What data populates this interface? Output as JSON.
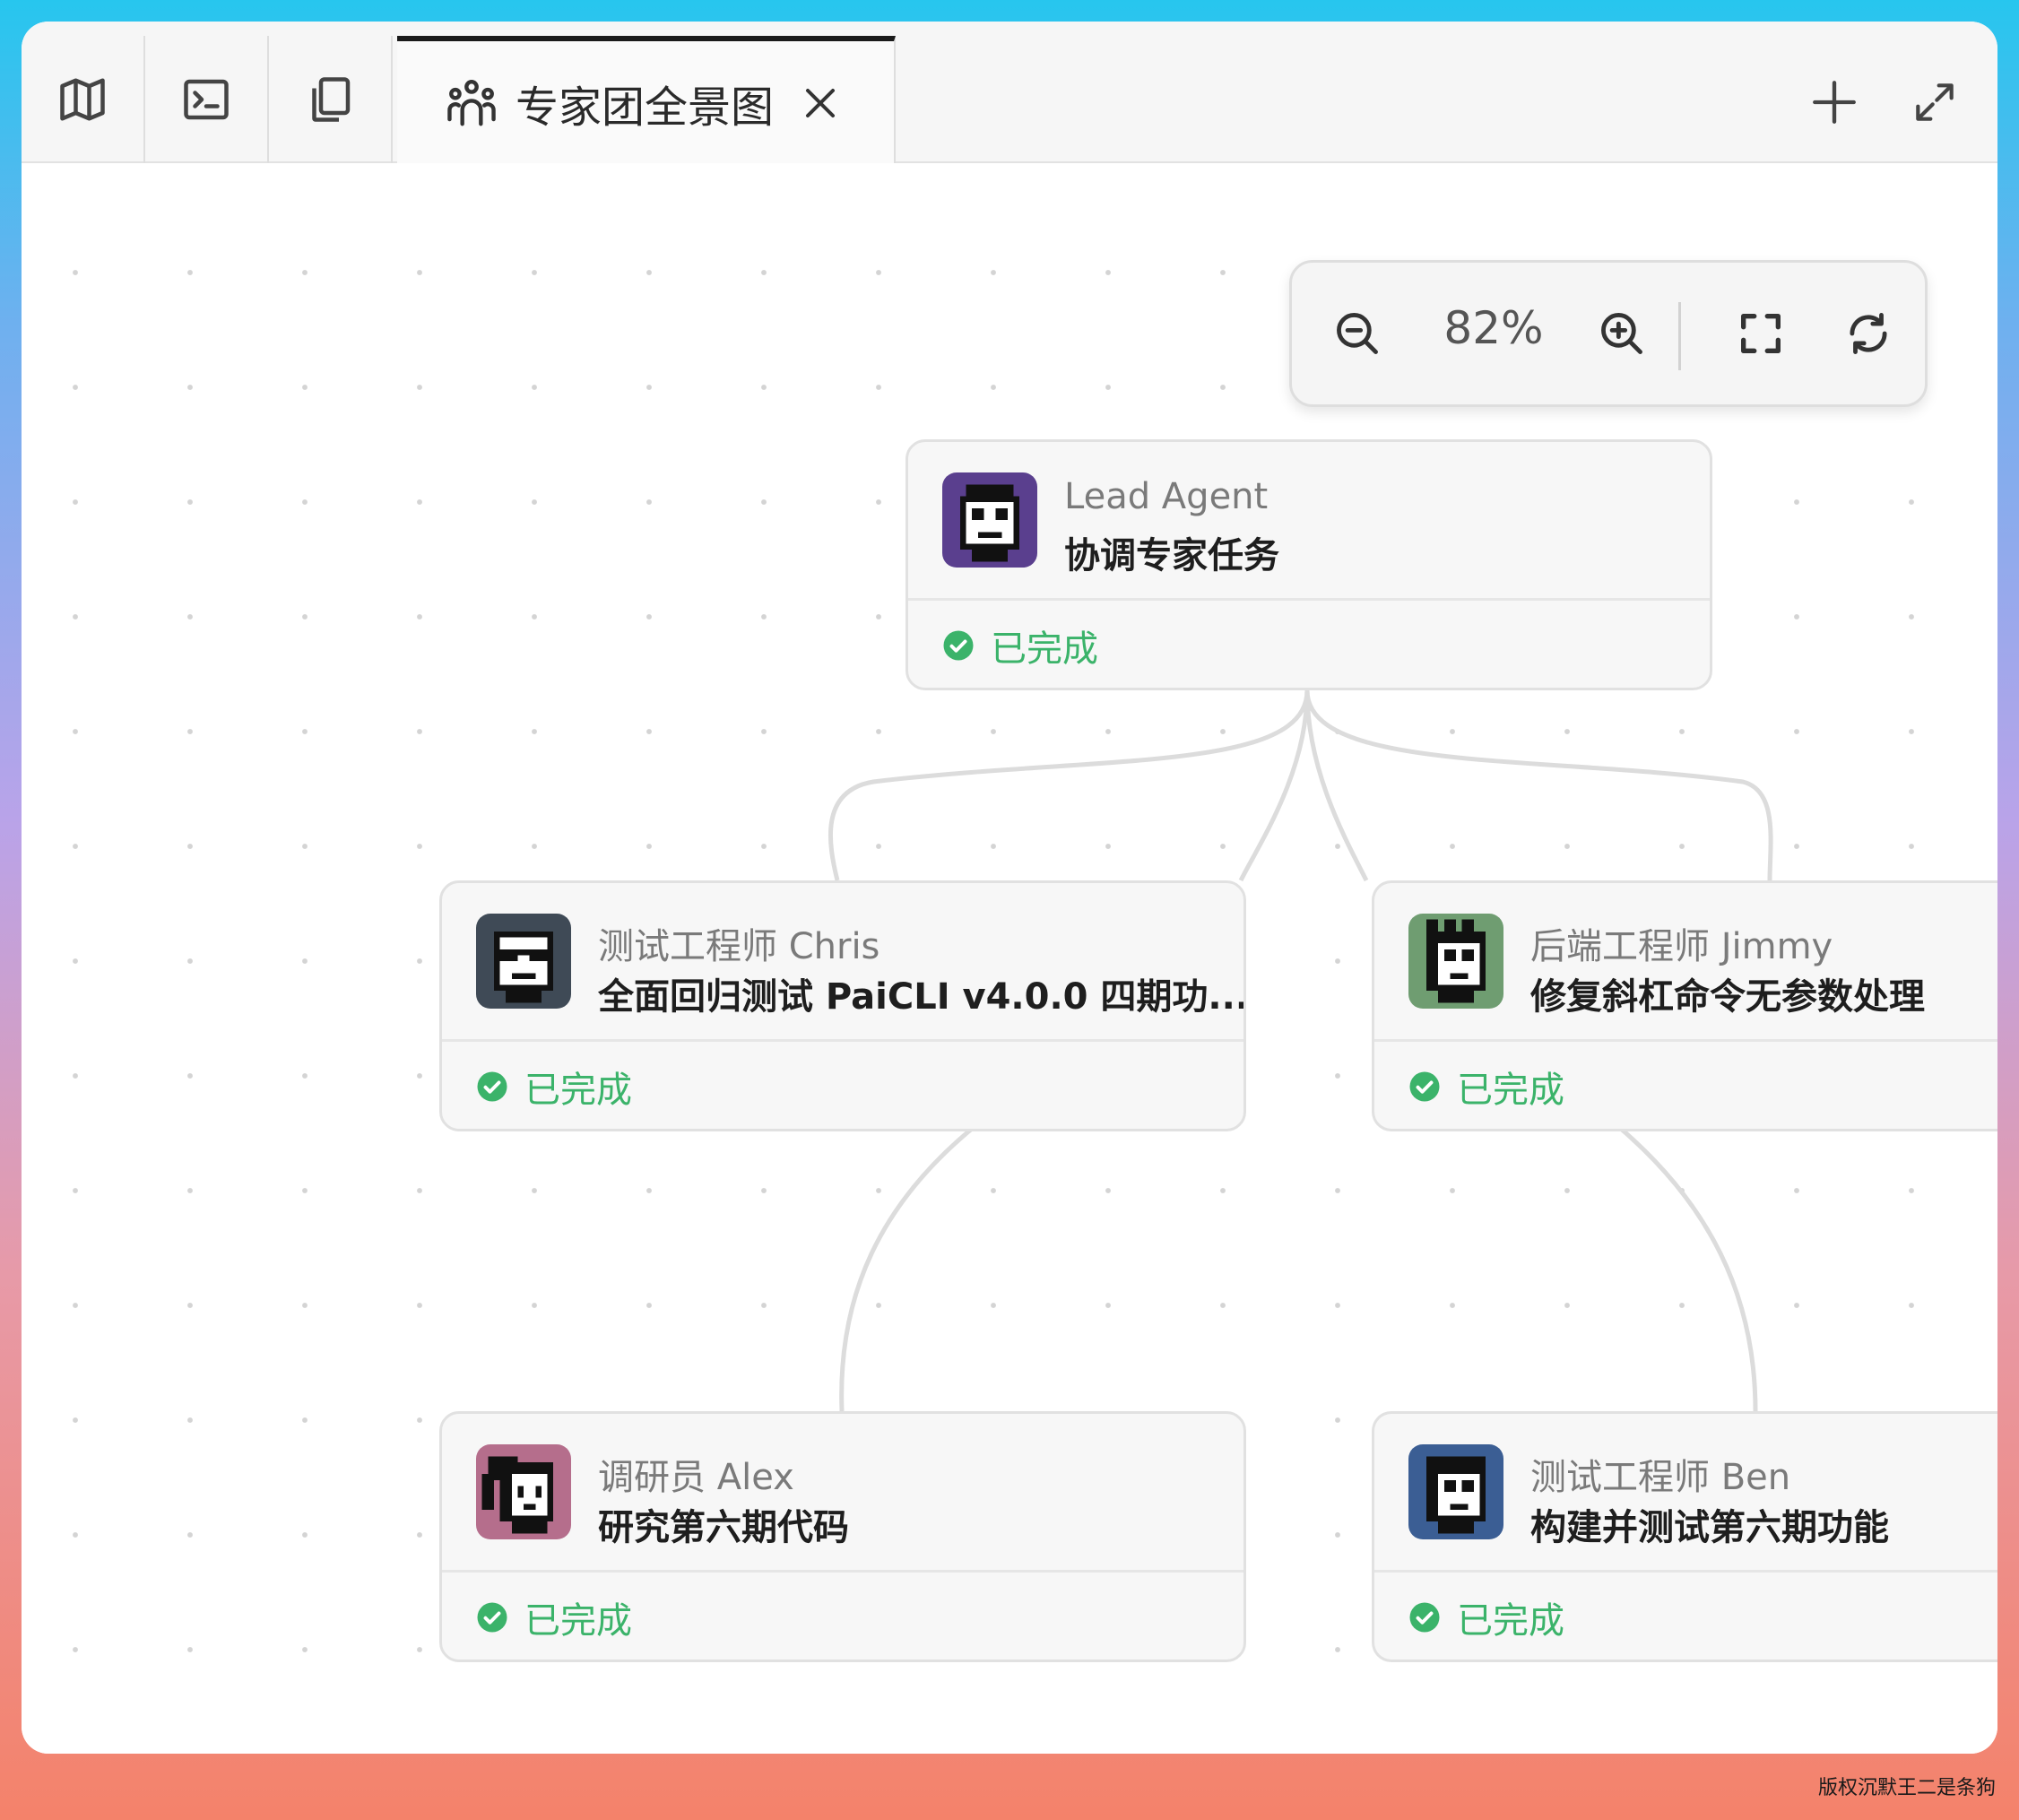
{
  "tabs": {
    "icon_tabs": [
      "map-icon",
      "terminal-icon",
      "copy-icon"
    ],
    "active": {
      "icon": "team-icon",
      "title": "专家团全景图"
    },
    "actions": [
      "add-icon",
      "expand-icon"
    ]
  },
  "zoom": {
    "value": "82%"
  },
  "nodes": {
    "lead": {
      "role": "Lead Agent",
      "task": "协调专家任务",
      "status": "已完成",
      "avatar_bg": "#5a3f8e"
    },
    "chris": {
      "role": "测试工程师 Chris",
      "task": "全面回归测试 PaiCLI v4.0.0 四期功...",
      "status": "已完成",
      "avatar_bg": "#3f4a56"
    },
    "jimmy": {
      "role": "后端工程师 Jimmy",
      "task": "修复斜杠命令无参数处理",
      "status": "已完成",
      "avatar_bg": "#6f9d71"
    },
    "alex": {
      "role": "调研员 Alex",
      "task": "研究第六期代码",
      "status": "已完成",
      "avatar_bg": "#b56e8c"
    },
    "ben": {
      "role": "测试工程师 Ben",
      "task": "构建并测试第六期功能",
      "status": "已完成",
      "avatar_bg": "#3b5e94"
    }
  },
  "colors": {
    "status_green": "#3bb36a",
    "edge": "#dcdcdc"
  },
  "watermark": "版权沉默王二是条狗"
}
